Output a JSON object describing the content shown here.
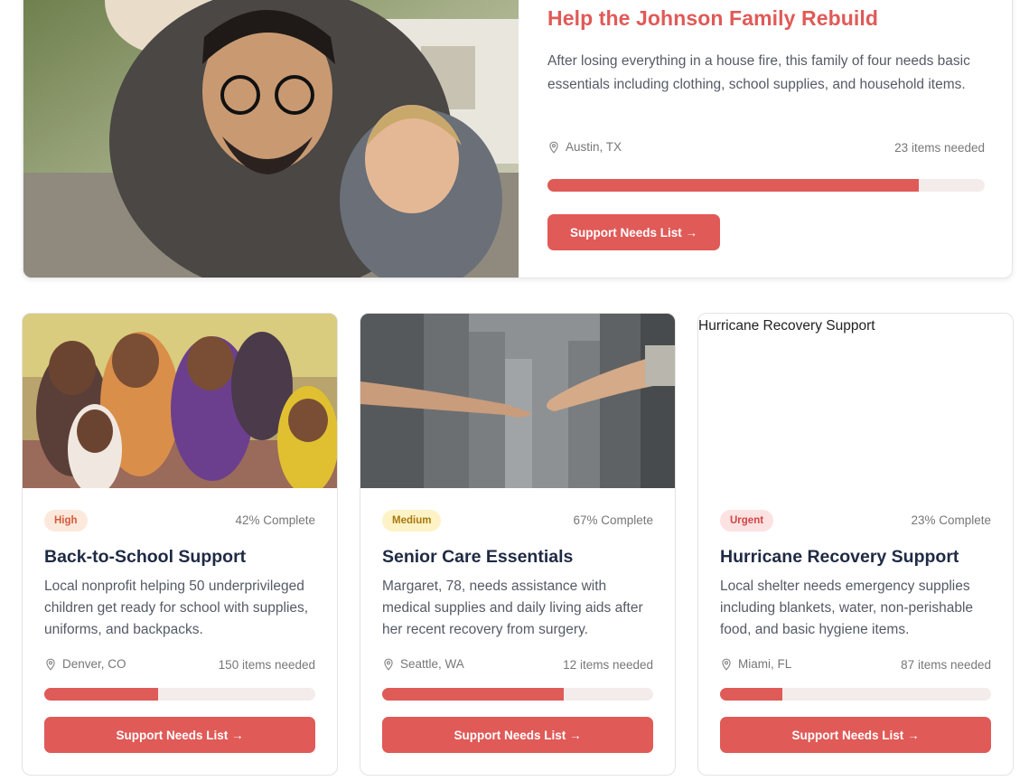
{
  "featured": {
    "photo_icon": "family-photo",
    "title": "Help the Johnson Family Rebuild",
    "description": "After losing everything in a house fire, this family of four needs basic essentials including clothing, school supplies, and household items.",
    "location": "Austin, TX",
    "items_needed": "23 items needed",
    "progress": 0.85,
    "button_label": "Support Needs List →"
  },
  "cards": [
    {
      "photo_icon": "children-photo",
      "priority": "High",
      "complete": "42% Complete",
      "progress": 0.42,
      "title": "Back-to-School Support",
      "description": "Local nonprofit helping 50 underprivileged children get ready for school with supplies, uniforms, and backpacks.",
      "location": "Denver, CO",
      "items_needed": "150 items needed",
      "button_label": "Support Needs List →"
    },
    {
      "photo_icon": "reaching-hands-photo",
      "priority": "Medium",
      "complete": "67% Complete",
      "progress": 0.67,
      "title": "Senior Care Essentials",
      "description": "Margaret, 78, needs assistance with medical supplies and daily living aids after her recent recovery from surgery.",
      "location": "Seattle, WA",
      "items_needed": "12 items needed",
      "button_label": "Support Needs List →"
    },
    {
      "photo_alt": "Hurricane Recovery Support",
      "priority": "Urgent",
      "complete": "23% Complete",
      "progress": 0.23,
      "title": "Hurricane Recovery Support",
      "description": "Local shelter needs emergency supplies including blankets, water, non-perishable food, and basic hygiene items.",
      "location": "Miami, FL",
      "items_needed": "87 items needed",
      "button_label": "Support Needs List →"
    }
  ],
  "colors": {
    "accent": "#e05a57",
    "badge_high_bg": "#fde8dc",
    "badge_high_text": "#d45a3a",
    "badge_medium_bg": "#fdf3c7",
    "badge_medium_text": "#a8790d",
    "badge_urgent_bg": "#fde2e2",
    "badge_urgent_text": "#d14545"
  }
}
